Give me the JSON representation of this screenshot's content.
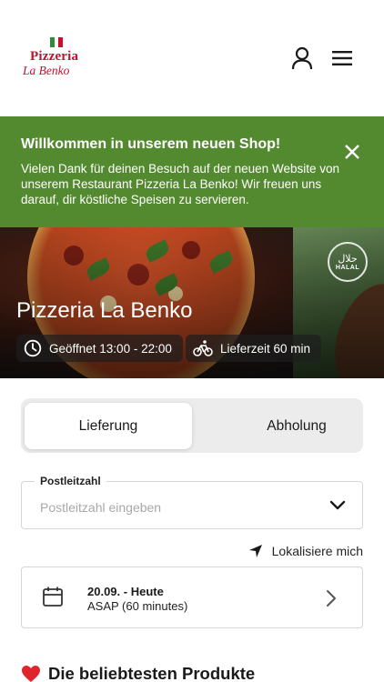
{
  "header": {
    "logo_line1": "Pizzeria",
    "logo_line2": "La Benko",
    "account_icon": "user-icon",
    "menu_icon": "hamburger-menu-icon"
  },
  "banner": {
    "title": "Willkommen in unserem neuen Shop!",
    "text": "Vielen Dank für deinen Besuch auf der neuen Website von unserem Restaurant Pizzeria La Benko! Wir freuen uns darauf, dir köstliche Speisen zu servieren.",
    "close_icon": "close-icon",
    "bg_color": "#548a2f"
  },
  "hero": {
    "title": "Pizzeria La Benko",
    "halal_ar": "حلال",
    "halal_en": "HALAL",
    "opening": "Geöffnet 13:00 - 22:00",
    "delivery_time": "Lieferzeit 60 min"
  },
  "order_mode": {
    "options": [
      "Lieferung",
      "Abholung"
    ],
    "selected": "Lieferung"
  },
  "postal": {
    "label": "Postleitzahl",
    "placeholder": "Postleitzahl eingeben"
  },
  "locate": {
    "label": "Lokalisiere mich"
  },
  "schedule": {
    "date": "20.09. - Heute",
    "time": "ASAP (60 minutes)"
  },
  "popular": {
    "title": "Die beliebtesten Produkte"
  }
}
